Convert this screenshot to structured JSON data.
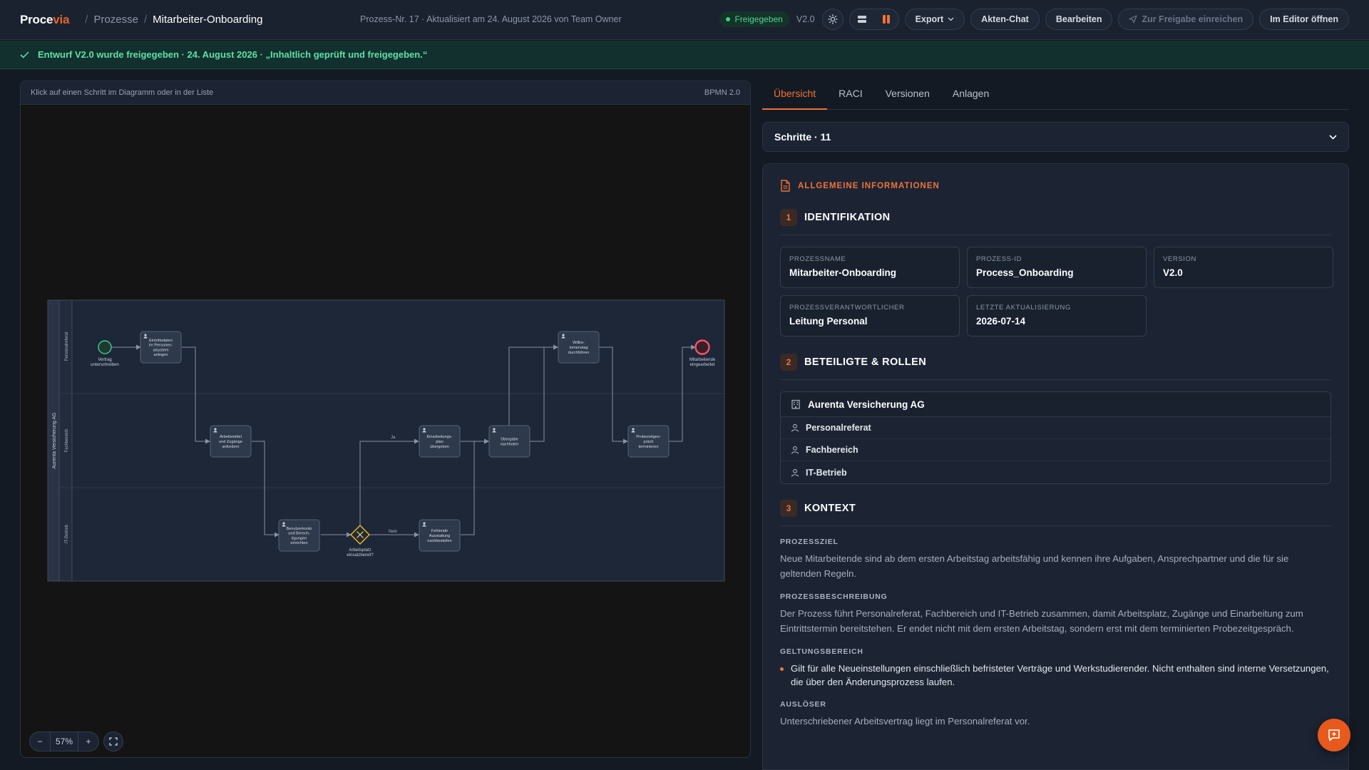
{
  "app": {
    "logo_main": "Proce",
    "logo_accent": "via"
  },
  "breadcrumb": {
    "root": "Prozesse",
    "current": "Mitarbeiter-Onboarding"
  },
  "meta": "Prozess-Nr. 17 · Aktualisiert am 24. August 2026 von Team Owner",
  "header": {
    "status": "Freigegeben",
    "version": "V2.0",
    "export_label": "Export",
    "chat_label": "Akten-Chat",
    "edit_label": "Bearbeiten",
    "submit_label": "Zur Freigabe einreichen",
    "editor_label": "Im Editor öffnen"
  },
  "banner": {
    "text": "Entwurf V2.0 wurde freigegeben · 24. August 2026 · „Inhaltlich geprüft und freigegeben.“"
  },
  "diagram": {
    "hint": "Klick auf einen Schritt im Diagramm oder in der Liste",
    "notation": "BPMN 2.0",
    "pool": "Aurenta Versicherung AG",
    "lanes": [
      "Personalreferat",
      "Fachbereich",
      "IT-Betrieb"
    ],
    "start_label": "Vertrag unterschreiben",
    "end_label": "Mitarbeitende eingearbeitet",
    "gateway_label": "Arbeitsplatz einsatzbereit?",
    "flow_yes": "Ja",
    "flow_no": "Nein",
    "tasks": [
      {
        "id": "t1",
        "lines": [
          "Eintrittsdaten",
          "im Personen-",
          "alsystem",
          "anlegen"
        ]
      },
      {
        "id": "t2",
        "lines": [
          "Arbeitsmittel",
          "und Zugänge",
          "anfordern"
        ]
      },
      {
        "id": "t3",
        "lines": [
          "Benutzerkonto",
          "und Berech-",
          "tigungen",
          "einrichten"
        ]
      },
      {
        "id": "t4",
        "lines": [
          "Einarbeitungs-",
          "plan",
          "übergeben"
        ]
      },
      {
        "id": "t5",
        "lines": [
          "Fehlende",
          "Ausstattung",
          "nachbestellen"
        ]
      },
      {
        "id": "t6",
        "lines": [
          "Übergabe",
          "nachholen"
        ]
      },
      {
        "id": "t7",
        "lines": [
          "Willko-",
          "mmenstag",
          "durchführen"
        ]
      },
      {
        "id": "t8",
        "lines": [
          "Probezeitges-",
          "präch",
          "terminieren"
        ]
      }
    ],
    "zoom": "57%"
  },
  "tabs": [
    "Übersicht",
    "RACI",
    "Versionen",
    "Anlagen"
  ],
  "steps_label": "Schritte · 11",
  "info": {
    "title": "ALLGEMEINE INFORMATIONEN",
    "s1": {
      "num": "1",
      "title": "IDENTIFIKATION",
      "fields": [
        {
          "label": "PROZESSNAME",
          "value": "Mitarbeiter-Onboarding"
        },
        {
          "label": "PROZESS-ID",
          "value": "Process_Onboarding"
        },
        {
          "label": "VERSION",
          "value": "V2.0"
        },
        {
          "label": "PROZESSVERANTWORTLICHER",
          "value": "Leitung Personal"
        },
        {
          "label": "LETZTE AKTUALISIERUNG",
          "value": "2026-07-14"
        }
      ]
    },
    "s2": {
      "num": "2",
      "title": "BETEILIGTE & ROLLEN",
      "org": "Aurenta Versicherung AG",
      "roles": [
        "Personalreferat",
        "Fachbereich",
        "IT-Betrieb"
      ]
    },
    "s3": {
      "num": "3",
      "title": "KONTEXT",
      "goal_label": "PROZESSZIEL",
      "goal": "Neue Mitarbeitende sind ab dem ersten Arbeitstag arbeitsfähig und kennen ihre Aufgaben, Ansprechpartner und die für sie geltenden Regeln.",
      "desc_label": "PROZESSBESCHREIBUNG",
      "desc": "Der Prozess führt Personalreferat, Fachbereich und IT-Betrieb zusammen, damit Arbeitsplatz, Zugänge und Einarbeitung zum Eintrittstermin bereitstehen. Er endet nicht mit dem ersten Arbeitstag, sondern erst mit dem terminierten Probezeitgespräch.",
      "scope_label": "GELTUNGSBEREICH",
      "scope": "Gilt für alle Neueinstellungen einschließlich befristeter Verträge und Werkstudierender. Nicht enthalten sind interne Versetzungen, die über den Änderungsprozess laufen.",
      "trigger_label": "AUSLÖSER",
      "trigger": "Unterschriebener Arbeitsvertrag liegt im Personalreferat vor."
    }
  }
}
